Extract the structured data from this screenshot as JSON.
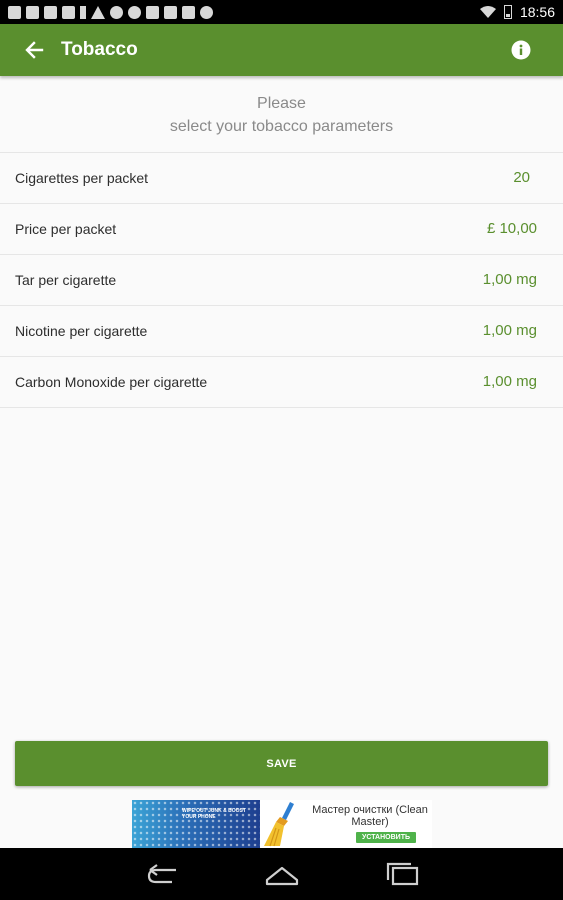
{
  "status_bar": {
    "time": "18:56",
    "notification_icons": [
      "facebook-icon",
      "facebook-icon",
      "facebook-icon",
      "image-icon",
      "download-icon",
      "warning-icon",
      "chrome-icon",
      "pinterest-icon",
      "mail-icon",
      "store-icon",
      "camera-icon",
      "gear-icon"
    ],
    "wifi_icon": "wifi-icon",
    "battery_icon": "battery-icon"
  },
  "app_bar": {
    "title": "Tobacco",
    "back_icon": "arrow-left-icon",
    "info_icon": "info-icon",
    "background_color": "#5a8f2e"
  },
  "intro": {
    "line1": "Please",
    "line2": "select your tobacco parameters"
  },
  "parameters": [
    {
      "label": "Cigarettes per packet",
      "value": "20"
    },
    {
      "label": "Price per packet",
      "value": "£ 10,00"
    },
    {
      "label": "Tar per cigarette",
      "value": "1,00 mg"
    },
    {
      "label": "Nicotine per cigarette",
      "value": "1,00 mg"
    },
    {
      "label": "Carbon Monoxide per cigarette",
      "value": "1,00 mg"
    }
  ],
  "save_button": {
    "label": "SAVE"
  },
  "ad": {
    "tagline": "WIPE OUT JUNK & BOOST YOUR PHONE",
    "title": "Мастер очистки (Clean Master)",
    "install_label": "УСТАНОВИТЬ",
    "broom_icon": "broom-icon"
  },
  "nav_bar": {
    "back_icon": "nav-back-icon",
    "home_icon": "nav-home-icon",
    "recents_icon": "nav-recents-icon"
  },
  "colors": {
    "accent": "#5a8f2e",
    "value_text": "#5a8f2e",
    "intro_text": "#8a8a8a"
  }
}
